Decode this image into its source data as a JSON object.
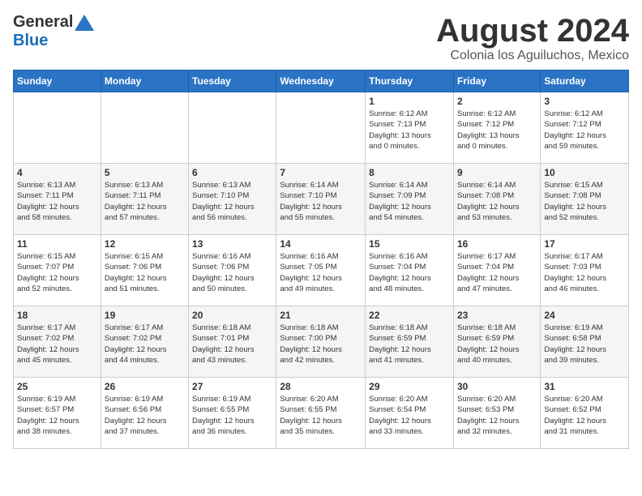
{
  "logo": {
    "general": "General",
    "blue": "Blue"
  },
  "header": {
    "month": "August 2024",
    "location": "Colonia los Aguiluchos, Mexico"
  },
  "days_of_week": [
    "Sunday",
    "Monday",
    "Tuesday",
    "Wednesday",
    "Thursday",
    "Friday",
    "Saturday"
  ],
  "weeks": [
    [
      {
        "day": "",
        "info": ""
      },
      {
        "day": "",
        "info": ""
      },
      {
        "day": "",
        "info": ""
      },
      {
        "day": "",
        "info": ""
      },
      {
        "day": "1",
        "info": "Sunrise: 6:12 AM\nSunset: 7:13 PM\nDaylight: 13 hours\nand 0 minutes."
      },
      {
        "day": "2",
        "info": "Sunrise: 6:12 AM\nSunset: 7:12 PM\nDaylight: 13 hours\nand 0 minutes."
      },
      {
        "day": "3",
        "info": "Sunrise: 6:12 AM\nSunset: 7:12 PM\nDaylight: 12 hours\nand 59 minutes."
      }
    ],
    [
      {
        "day": "4",
        "info": "Sunrise: 6:13 AM\nSunset: 7:11 PM\nDaylight: 12 hours\nand 58 minutes."
      },
      {
        "day": "5",
        "info": "Sunrise: 6:13 AM\nSunset: 7:11 PM\nDaylight: 12 hours\nand 57 minutes."
      },
      {
        "day": "6",
        "info": "Sunrise: 6:13 AM\nSunset: 7:10 PM\nDaylight: 12 hours\nand 56 minutes."
      },
      {
        "day": "7",
        "info": "Sunrise: 6:14 AM\nSunset: 7:10 PM\nDaylight: 12 hours\nand 55 minutes."
      },
      {
        "day": "8",
        "info": "Sunrise: 6:14 AM\nSunset: 7:09 PM\nDaylight: 12 hours\nand 54 minutes."
      },
      {
        "day": "9",
        "info": "Sunrise: 6:14 AM\nSunset: 7:08 PM\nDaylight: 12 hours\nand 53 minutes."
      },
      {
        "day": "10",
        "info": "Sunrise: 6:15 AM\nSunset: 7:08 PM\nDaylight: 12 hours\nand 52 minutes."
      }
    ],
    [
      {
        "day": "11",
        "info": "Sunrise: 6:15 AM\nSunset: 7:07 PM\nDaylight: 12 hours\nand 52 minutes."
      },
      {
        "day": "12",
        "info": "Sunrise: 6:15 AM\nSunset: 7:06 PM\nDaylight: 12 hours\nand 51 minutes."
      },
      {
        "day": "13",
        "info": "Sunrise: 6:16 AM\nSunset: 7:06 PM\nDaylight: 12 hours\nand 50 minutes."
      },
      {
        "day": "14",
        "info": "Sunrise: 6:16 AM\nSunset: 7:05 PM\nDaylight: 12 hours\nand 49 minutes."
      },
      {
        "day": "15",
        "info": "Sunrise: 6:16 AM\nSunset: 7:04 PM\nDaylight: 12 hours\nand 48 minutes."
      },
      {
        "day": "16",
        "info": "Sunrise: 6:17 AM\nSunset: 7:04 PM\nDaylight: 12 hours\nand 47 minutes."
      },
      {
        "day": "17",
        "info": "Sunrise: 6:17 AM\nSunset: 7:03 PM\nDaylight: 12 hours\nand 46 minutes."
      }
    ],
    [
      {
        "day": "18",
        "info": "Sunrise: 6:17 AM\nSunset: 7:02 PM\nDaylight: 12 hours\nand 45 minutes."
      },
      {
        "day": "19",
        "info": "Sunrise: 6:17 AM\nSunset: 7:02 PM\nDaylight: 12 hours\nand 44 minutes."
      },
      {
        "day": "20",
        "info": "Sunrise: 6:18 AM\nSunset: 7:01 PM\nDaylight: 12 hours\nand 43 minutes."
      },
      {
        "day": "21",
        "info": "Sunrise: 6:18 AM\nSunset: 7:00 PM\nDaylight: 12 hours\nand 42 minutes."
      },
      {
        "day": "22",
        "info": "Sunrise: 6:18 AM\nSunset: 6:59 PM\nDaylight: 12 hours\nand 41 minutes."
      },
      {
        "day": "23",
        "info": "Sunrise: 6:18 AM\nSunset: 6:59 PM\nDaylight: 12 hours\nand 40 minutes."
      },
      {
        "day": "24",
        "info": "Sunrise: 6:19 AM\nSunset: 6:58 PM\nDaylight: 12 hours\nand 39 minutes."
      }
    ],
    [
      {
        "day": "25",
        "info": "Sunrise: 6:19 AM\nSunset: 6:57 PM\nDaylight: 12 hours\nand 38 minutes."
      },
      {
        "day": "26",
        "info": "Sunrise: 6:19 AM\nSunset: 6:56 PM\nDaylight: 12 hours\nand 37 minutes."
      },
      {
        "day": "27",
        "info": "Sunrise: 6:19 AM\nSunset: 6:55 PM\nDaylight: 12 hours\nand 36 minutes."
      },
      {
        "day": "28",
        "info": "Sunrise: 6:20 AM\nSunset: 6:55 PM\nDaylight: 12 hours\nand 35 minutes."
      },
      {
        "day": "29",
        "info": "Sunrise: 6:20 AM\nSunset: 6:54 PM\nDaylight: 12 hours\nand 33 minutes."
      },
      {
        "day": "30",
        "info": "Sunrise: 6:20 AM\nSunset: 6:53 PM\nDaylight: 12 hours\nand 32 minutes."
      },
      {
        "day": "31",
        "info": "Sunrise: 6:20 AM\nSunset: 6:52 PM\nDaylight: 12 hours\nand 31 minutes."
      }
    ]
  ]
}
